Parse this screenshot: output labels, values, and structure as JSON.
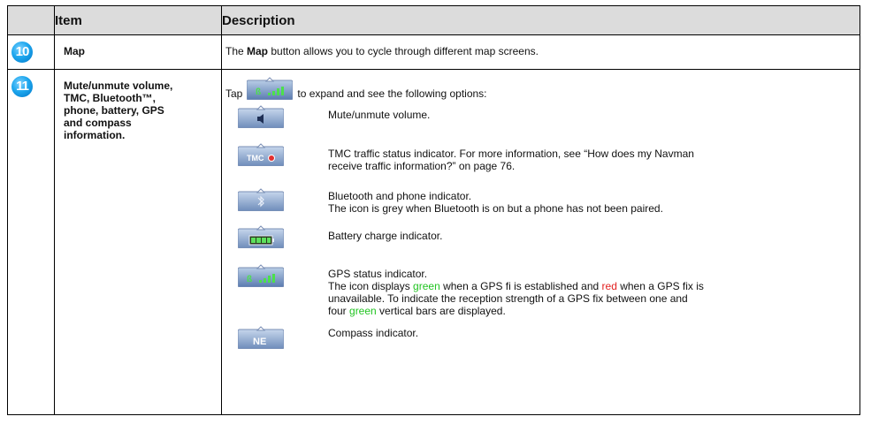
{
  "table": {
    "header": {
      "item": "Item",
      "description": "Description"
    },
    "rows": [
      {
        "number": "10",
        "item": "Map",
        "desc_pre": "The ",
        "desc_bold": "Map",
        "desc_post": " button allows you to cycle through different map screens."
      },
      {
        "number": "11",
        "item_lines": [
          "Mute/unmute volume,",
          "TMC, Bluetooth™,",
          "phone, battery, GPS",
          "and compass",
          "information."
        ],
        "tap_pre": "Tap",
        "tap_post": "to expand and see the following options:",
        "options": [
          {
            "icon": "speaker-icon",
            "lines": [
              "Mute/unmute volume."
            ]
          },
          {
            "icon": "tmc-icon",
            "icon_label": "TMC",
            "lines": [
              "TMC traffic status indicator. For more information, see “How does my Navman",
              "receive traffic information?” on page 76."
            ]
          },
          {
            "icon": "bluetooth-icon",
            "lines": [
              "Bluetooth and phone indicator.",
              "The icon is grey when Bluetooth is on but a phone has not been paired."
            ]
          },
          {
            "icon": "battery-icon",
            "lines": [
              "Battery charge indicator."
            ]
          },
          {
            "icon": "gps-icon",
            "line1": "GPS status indicator.",
            "line2_a": "The icon displays ",
            "line2_green": "green",
            "line2_b": " when a GPS fi is established and ",
            "line2_red": "red",
            "line2_c": " when a GPS fix is",
            "line3": "unavailable. To indicate the reception strength of a GPS fix between one and",
            "line4_a": "four ",
            "line4_green": "green",
            "line4_b": " vertical bars are displayed."
          },
          {
            "icon": "compass-icon",
            "icon_label": "NE",
            "lines": [
              "Compass indicator."
            ]
          }
        ]
      }
    ]
  },
  "colors": {
    "header_bg": "#dcdcdc",
    "badge": "#1ea7ee",
    "green": "#22c422",
    "red": "#e22020"
  }
}
